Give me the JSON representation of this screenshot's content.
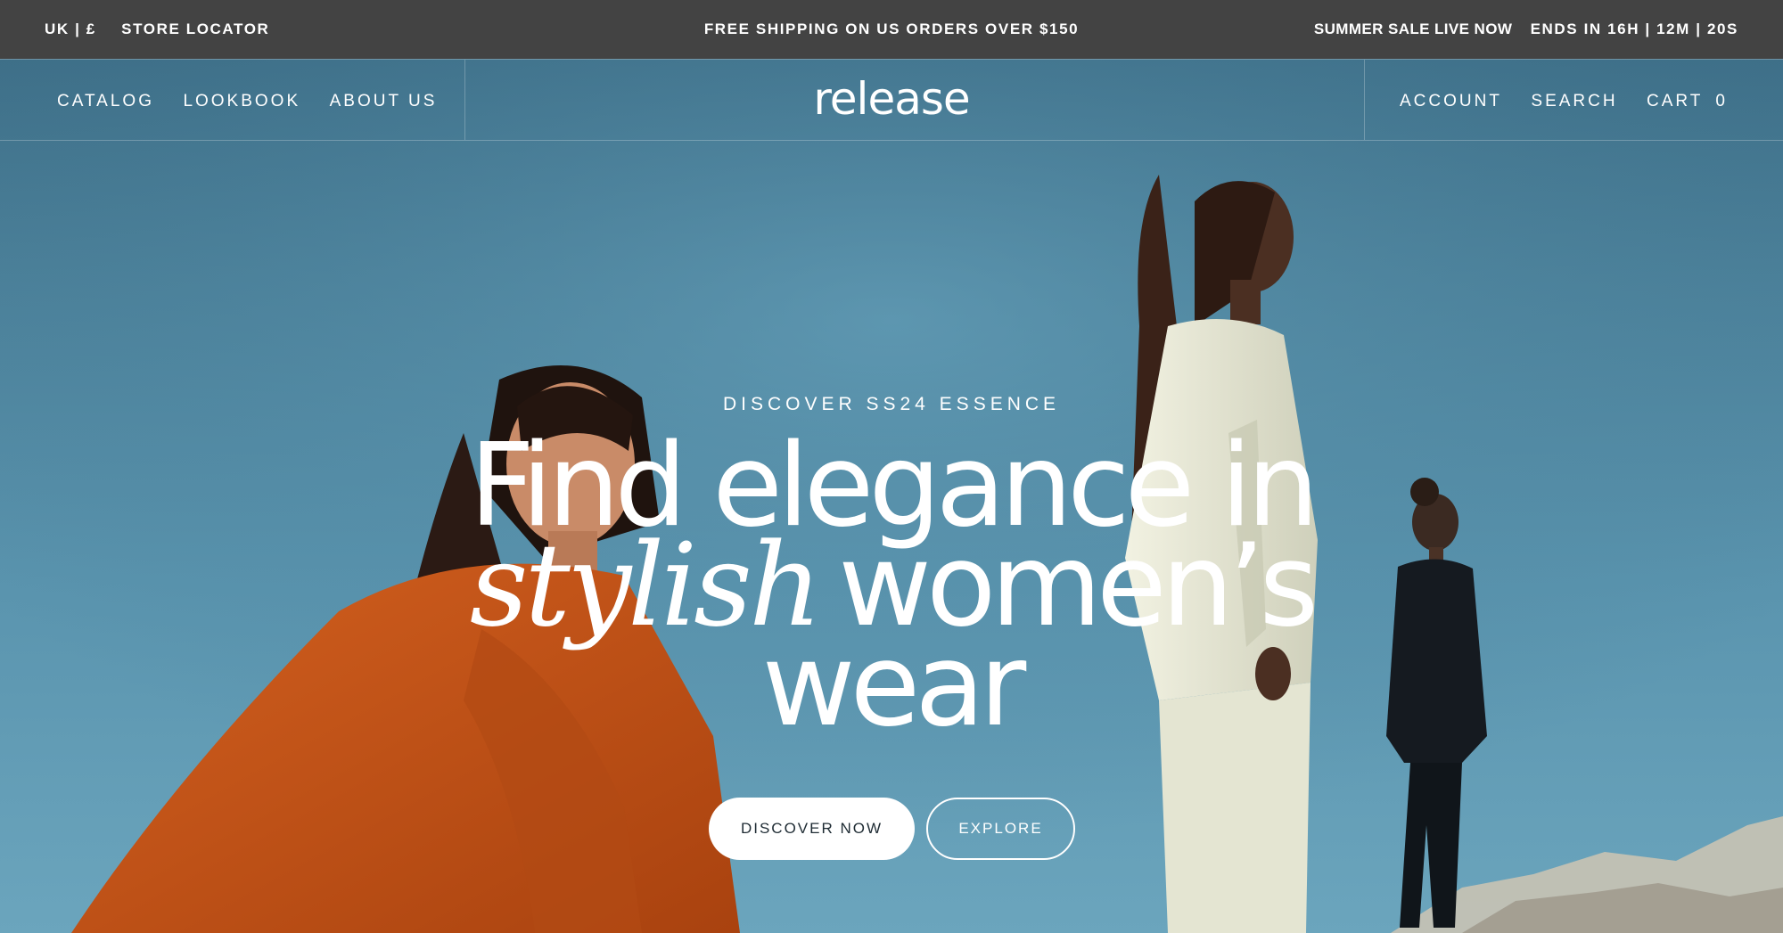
{
  "announcement": {
    "region": "UK | £",
    "store_locator": "STORE LOCATOR",
    "shipping": "FREE SHIPPING ON US ORDERS OVER $150",
    "sale": "SUMMER SALE LIVE NOW",
    "countdown": "ENDS IN 16H | 12M | 20S"
  },
  "nav": {
    "left": [
      "CATALOG",
      "LOOKBOOK",
      "ABOUT US"
    ],
    "logo": "release",
    "account": "ACCOUNT",
    "search": "SEARCH",
    "cart": "CART",
    "cart_count": "0"
  },
  "hero": {
    "eyebrow": "DISCOVER SS24 ESSENCE",
    "headline_line1": "Find elegance in",
    "headline_accent": "stylish",
    "headline_line2_rest": "women’s",
    "headline_line3": "wear",
    "primary_cta": "DISCOVER NOW",
    "secondary_cta": "EXPLORE"
  },
  "colors": {
    "topbar": "#434343",
    "sky": "#4f8aa5",
    "orange_coat": "#c9541b",
    "cream_suit": "#e9ead6",
    "white": "#ffffff"
  }
}
